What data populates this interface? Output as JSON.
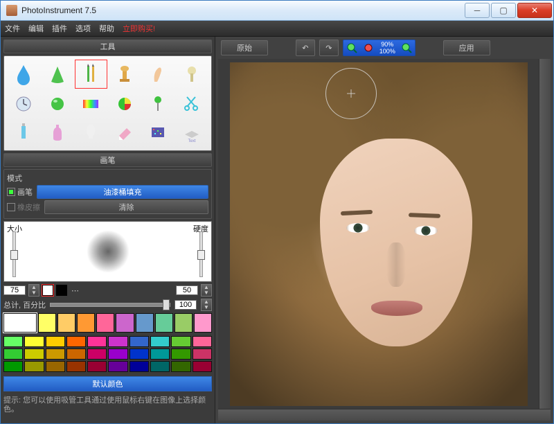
{
  "window": {
    "title": "PhotoInstrument 7.5"
  },
  "menu": {
    "file": "文件",
    "edit": "编辑",
    "plugins": "插件",
    "options": "选项",
    "help": "帮助",
    "buy": "立即购买!"
  },
  "panels": {
    "tools_header": "工具",
    "brush_header": "画笔"
  },
  "brush": {
    "mode_label": "模式",
    "brush_radio": "画笔",
    "eraser_radio": "橡皮擦",
    "bucket_fill": "油漆桶填充",
    "clear": "清除",
    "size_label": "大小",
    "hardness_label": "硬度",
    "size_value": "75",
    "hardness_value": "50",
    "opacity_label": "总计, 百分比",
    "opacity_value": "100",
    "default_colors": "默认颜色"
  },
  "hint": "提示: 您可以使用吸管工具通过使用鼠标右键在图像上选择颜色。",
  "topbar": {
    "original": "原始",
    "apply": "应用",
    "zoom1": "90%",
    "zoom2": "100%"
  },
  "swatches": {
    "big": "#ffffff",
    "row1": [
      "#ffff66",
      "#ffcc66",
      "#ff9933",
      "#ff6699",
      "#cc66cc",
      "#6699cc",
      "#66cc99",
      "#99cc66",
      "#ff99cc"
    ],
    "rows": [
      [
        "#66ff66",
        "#ffff33",
        "#ffcc00",
        "#ff6600",
        "#ff3399",
        "#cc33cc",
        "#3366cc",
        "#33cccc",
        "#66cc33",
        "#ff6699"
      ],
      [
        "#33cc33",
        "#cccc00",
        "#cc9900",
        "#cc6600",
        "#cc0066",
        "#9900cc",
        "#0033cc",
        "#009999",
        "#339900",
        "#cc3366"
      ],
      [
        "#009900",
        "#999900",
        "#996600",
        "#993300",
        "#990033",
        "#660099",
        "#000099",
        "#006666",
        "#336600",
        "#990033"
      ]
    ]
  }
}
